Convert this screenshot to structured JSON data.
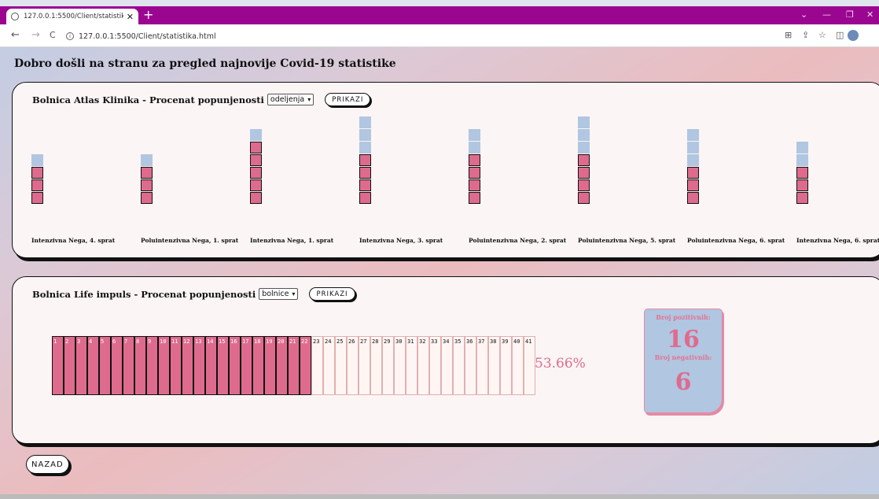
{
  "browser": {
    "tab_title": "127.0.0.1:5500/Client/statistika.ht",
    "url": "127.0.0.1:5500/Client/statistika.html",
    "new_tab": "+",
    "close": "✕",
    "back": "←",
    "forward": "→",
    "reload": "C",
    "minimize": "—",
    "maximize": "❐",
    "winclose": "✕",
    "chevron": "⌄"
  },
  "page": {
    "title": "Dobro došli na stranu za pregled najnovije Covid-19 statistike"
  },
  "hospital1": {
    "title": "Bolnica Atlas Klinika - Procenat popunjenosti",
    "select_value": "odeljenja",
    "button": "PRIKAZI",
    "wards": [
      {
        "label": "Intenzivna Nega, 4. sprat",
        "filled": 3,
        "empty": 1
      },
      {
        "label": "Poluintenzivna Nega, 1. sprat",
        "filled": 3,
        "empty": 1
      },
      {
        "label": "Intenzivna Nega, 1. sprat",
        "filled": 5,
        "empty": 1
      },
      {
        "label": "Intenzivna Nega, 3. sprat",
        "filled": 4,
        "empty": 3
      },
      {
        "label": "Poluintenzivna Nega, 2. sprat",
        "filled": 4,
        "empty": 2
      },
      {
        "label": "Poluintenzivna Nega, 5. sprat",
        "filled": 4,
        "empty": 3
      },
      {
        "label": "Poluintenzivna Nega, 6. sprat",
        "filled": 3,
        "empty": 3
      },
      {
        "label": "Intenzivna Nega, 6. sprat",
        "filled": 3,
        "empty": 2
      }
    ]
  },
  "hospital2": {
    "title": "Bolnica Life impuls - Procenat popunjenosti",
    "select_value": "bolnice",
    "button": "PRIKAZI",
    "total_beds": 41,
    "occupied_beds": 22,
    "percent": "53.66%",
    "positive_label": "Broj pozitivnih:",
    "positive_value": "16",
    "negative_label": "Broj negativnih:",
    "negative_value": "6"
  },
  "back_button": "NAZAD",
  "colors": {
    "filled": "#de6b8e",
    "empty": "#b1c6e0",
    "tab_bar": "#9b0691"
  }
}
